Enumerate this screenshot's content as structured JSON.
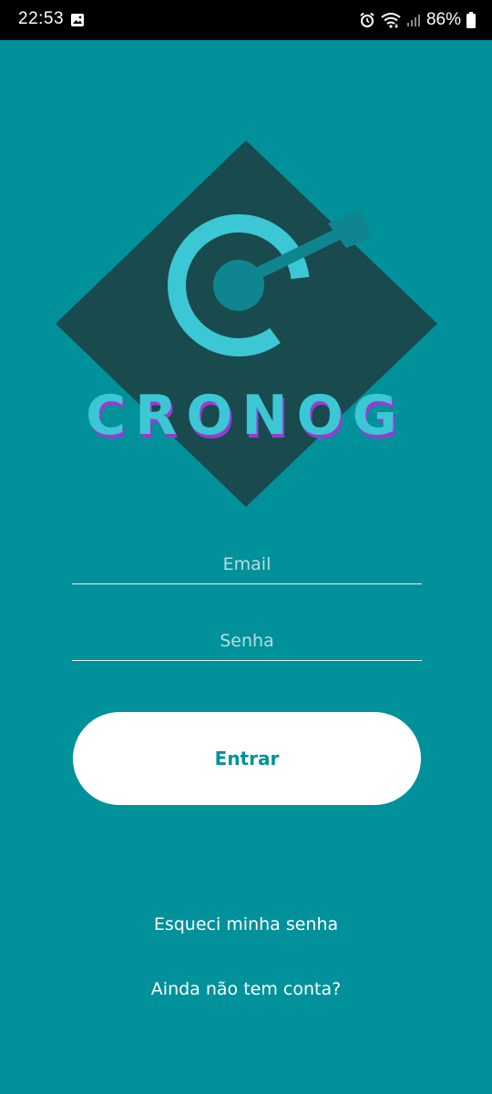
{
  "status_bar": {
    "time": "22:53",
    "battery": "86%",
    "icons": [
      "image-icon",
      "alarm-icon",
      "wifi-icon",
      "signal-icon",
      "battery-icon"
    ]
  },
  "logo": {
    "text": "CRONOG"
  },
  "form": {
    "email_placeholder": "Email",
    "password_placeholder": "Senha",
    "submit_label": "Entrar"
  },
  "links": {
    "forgot_password": "Esqueci minha senha",
    "no_account": "Ainda não tem conta?"
  },
  "colors": {
    "background": "#00919A",
    "diamond": "#194A4E",
    "logo_cyan": "#3CC7D5",
    "logo_shadow": "#9B3ACF",
    "button": "#FFFFFF",
    "button_text": "#00919A"
  }
}
